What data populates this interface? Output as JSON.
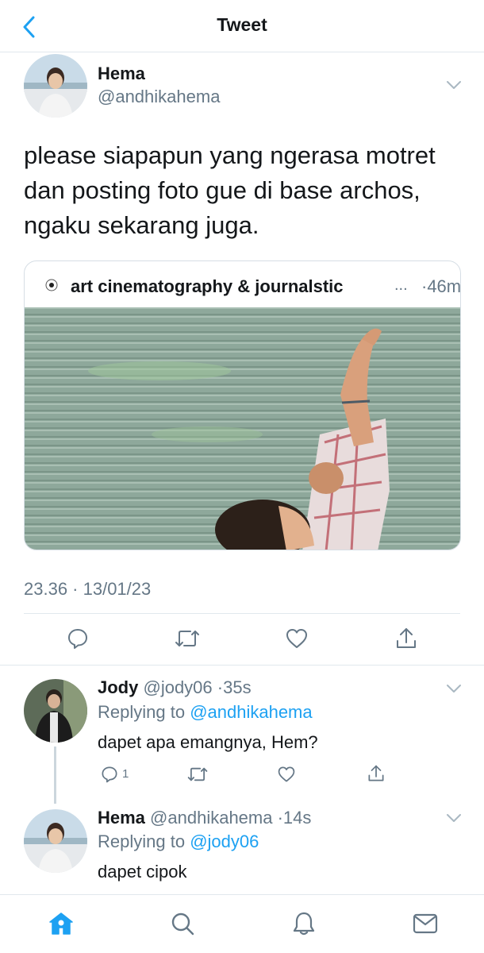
{
  "header": {
    "title": "Tweet"
  },
  "main_tweet": {
    "name": "Hema",
    "handle": "@andhikahema",
    "text": "please siapapun yang ngerasa motret dan posting foto gue di base archos, ngaku sekarang juga.",
    "quote": {
      "author": "art cinematography & journalstic",
      "ellipsis": "...",
      "time": "·46m"
    },
    "timestamp": "23.36 · 13/01/23"
  },
  "replies": [
    {
      "name": "Jody",
      "handle": "@jody06",
      "time": "·35s",
      "replying_prefix": "Replying to ",
      "replying_to": "@andhikahema",
      "text": "dapet apa emangnya, Hem?",
      "reply_count": "1"
    },
    {
      "name": "Hema",
      "handle": "@andhikahema",
      "time": "·14s",
      "replying_prefix": "Replying to ",
      "replying_to": "@jody06",
      "text": "dapet cipok"
    }
  ],
  "tabs": [
    "home",
    "search",
    "notifications",
    "messages"
  ],
  "icons": {
    "back": "chevron-left-icon",
    "more": "chevron-down-icon",
    "reply": "speech-bubble-icon",
    "retweet": "retweet-icon",
    "like": "heart-icon",
    "share": "share-icon",
    "home": "home-icon",
    "search": "search-icon",
    "notifications": "bell-icon",
    "messages": "envelope-icon"
  },
  "colors": {
    "accent": "#1da1f2",
    "text": "#14171a",
    "muted": "#657786",
    "divider": "#e1e8ed",
    "icon": "#657786"
  }
}
